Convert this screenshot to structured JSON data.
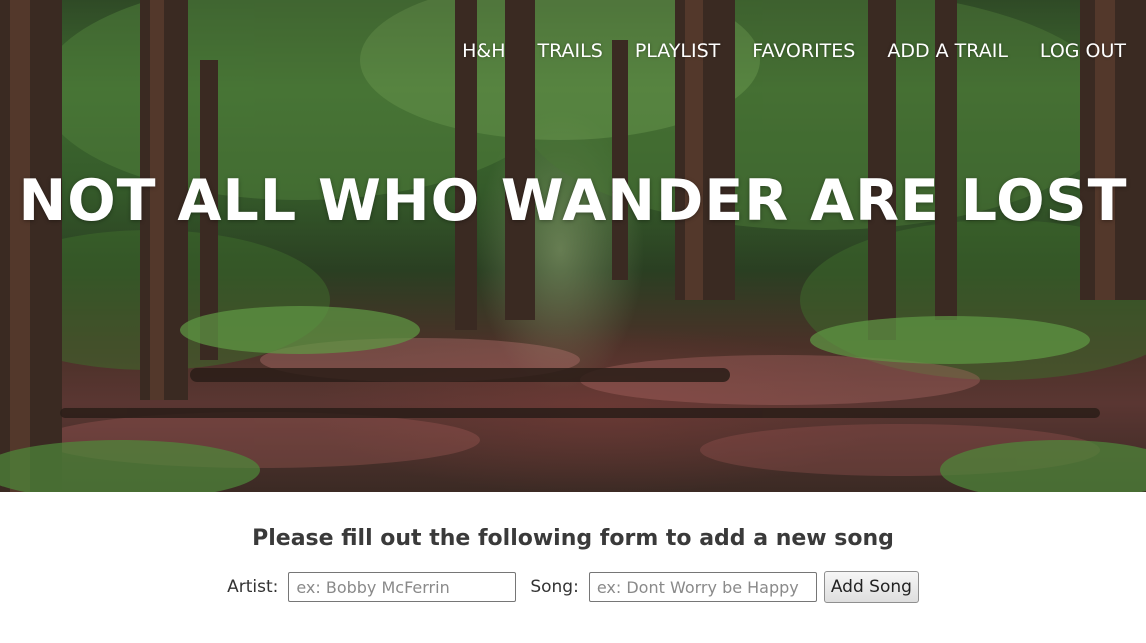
{
  "nav": {
    "items": [
      {
        "label": "H&H"
      },
      {
        "label": "TRAILS"
      },
      {
        "label": "PLAYLIST"
      },
      {
        "label": "FAVORITES"
      },
      {
        "label": "ADD A TRAIL"
      },
      {
        "label": "LOG OUT"
      }
    ]
  },
  "hero": {
    "headline": "NOT ALL WHO WANDER ARE LOST"
  },
  "form": {
    "title": "Please fill out the following form to add a new song",
    "artist_label": "Artist:",
    "artist_placeholder": "ex: Bobby McFerrin",
    "artist_value": "",
    "song_label": "Song:",
    "song_placeholder": "ex: Dont Worry be Happy",
    "song_value": "",
    "submit_label": "Add Song"
  }
}
